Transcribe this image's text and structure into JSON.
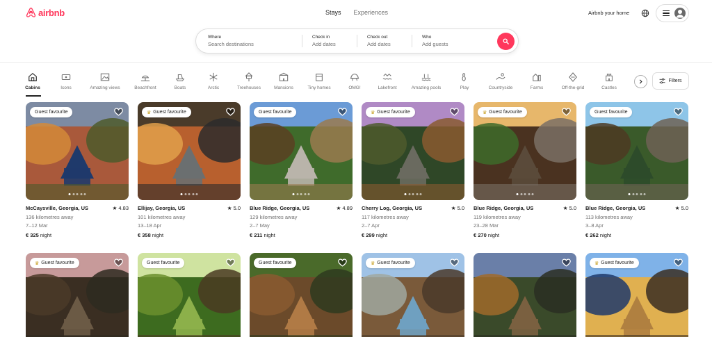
{
  "header": {
    "brand": "airbnb",
    "tabs": [
      {
        "label": "Stays",
        "active": true
      },
      {
        "label": "Experiences",
        "active": false
      }
    ],
    "host_link": "Airbnb your home",
    "colors": {
      "brand": "#ff385c"
    }
  },
  "search": {
    "where_label": "Where",
    "where_placeholder": "Search destinations",
    "checkin_label": "Check in",
    "checkin_placeholder": "Add dates",
    "checkout_label": "Check out",
    "checkout_placeholder": "Add dates",
    "who_label": "Who",
    "who_placeholder": "Add guests"
  },
  "categories": [
    {
      "label": "Cabins",
      "icon": "cabin-icon",
      "active": true
    },
    {
      "label": "Icons",
      "icon": "ticket-icon",
      "active": false
    },
    {
      "label": "Amazing views",
      "icon": "view-icon",
      "active": false
    },
    {
      "label": "Beachfront",
      "icon": "beach-icon",
      "active": false
    },
    {
      "label": "Boats",
      "icon": "boat-icon",
      "active": false
    },
    {
      "label": "Arctic",
      "icon": "snowflake-icon",
      "active": false
    },
    {
      "label": "Treehouses",
      "icon": "treehouse-icon",
      "active": false
    },
    {
      "label": "Mansions",
      "icon": "mansion-icon",
      "active": false
    },
    {
      "label": "Tiny homes",
      "icon": "tiny-home-icon",
      "active": false
    },
    {
      "label": "OMG!",
      "icon": "ufo-house-icon",
      "active": false
    },
    {
      "label": "Lakefront",
      "icon": "lake-icon",
      "active": false
    },
    {
      "label": "Amazing pools",
      "icon": "pool-icon",
      "active": false
    },
    {
      "label": "Play",
      "icon": "bowling-icon",
      "active": false
    },
    {
      "label": "Countryside",
      "icon": "countryside-icon",
      "active": false
    },
    {
      "label": "Farms",
      "icon": "farm-icon",
      "active": false
    },
    {
      "label": "Off-the-grid",
      "icon": "off-grid-icon",
      "active": false
    },
    {
      "label": "Castles",
      "icon": "castle-icon",
      "active": false
    }
  ],
  "filters_label": "Filters",
  "listings": [
    {
      "badge": "Guest favourite",
      "trophy": false,
      "location": "McCaysville, Georgia, US",
      "rating": "4.83",
      "distance": "136 kilometres away",
      "dates": "7–12 Mar",
      "price": "€ 325",
      "price_unit": "night"
    },
    {
      "badge": "Guest favourite",
      "trophy": true,
      "location": "Ellijay, Georgia, US",
      "rating": "5.0",
      "distance": "101 kilometres away",
      "dates": "13–18 Apr",
      "price": "€ 358",
      "price_unit": "night"
    },
    {
      "badge": "Guest favourite",
      "trophy": false,
      "location": "Blue Ridge, Georgia, US",
      "rating": "4.89",
      "distance": "129 kilometres away",
      "dates": "2–7 May",
      "price": "€ 211",
      "price_unit": "night"
    },
    {
      "badge": "Guest favourite",
      "trophy": true,
      "location": "Cherry Log, Georgia, US",
      "rating": "5.0",
      "distance": "117 kilometres away",
      "dates": "2–7 Apr",
      "price": "€ 299",
      "price_unit": "night"
    },
    {
      "badge": "Guest favourite",
      "trophy": true,
      "location": "Blue Ridge, Georgia, US",
      "rating": "5.0",
      "distance": "119 kilometres away",
      "dates": "23–28 Mar",
      "price": "€ 270",
      "price_unit": "night"
    },
    {
      "badge": "Guest favourite",
      "trophy": false,
      "location": "Blue Ridge, Georgia, US",
      "rating": "5.0",
      "distance": "113 kilometres away",
      "dates": "3–8 Apr",
      "price": "€ 262",
      "price_unit": "night"
    },
    {
      "badge": "Guest favourite",
      "trophy": true
    },
    {
      "badge": "Guest favourite",
      "trophy": false
    },
    {
      "badge": "Guest favourite",
      "trophy": false
    },
    {
      "badge": "Guest favourite",
      "trophy": true
    },
    {
      "badge": "",
      "trophy": false
    },
    {
      "badge": "Guest favourite",
      "trophy": true
    }
  ]
}
